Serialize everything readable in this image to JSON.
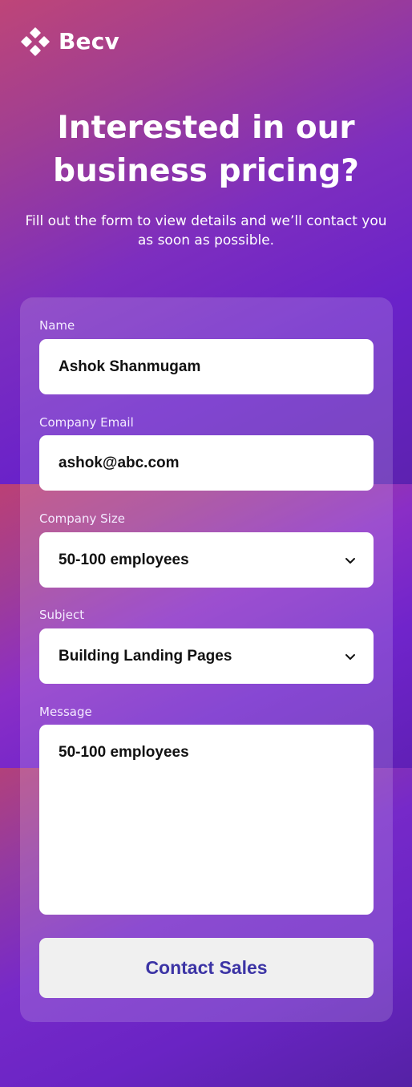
{
  "brand": {
    "name": "Becv",
    "logo_icon": "diamond-grid-logo-icon"
  },
  "hero": {
    "title_line1": "Interested in our",
    "title_line2": "business pricing?",
    "subtitle_line1": "Fill out the form to view details and we’ll contact you",
    "subtitle_line2": "as soon as possible."
  },
  "form": {
    "name": {
      "label": "Name",
      "value": "Ashok Shanmugam"
    },
    "email": {
      "label": "Company Email",
      "value": "ashok@abc.com"
    },
    "company_size": {
      "label": "Company Size",
      "value": "50-100 employees",
      "icon": "chevron-down-icon"
    },
    "subject": {
      "label": "Subject",
      "value": "Building Landing Pages",
      "icon": "chevron-down-icon"
    },
    "message": {
      "label": "Message",
      "value": "50-100 employees"
    },
    "submit_label": "Contact Sales"
  },
  "colors": {
    "accent_button_text": "#3c34a5",
    "button_background": "#f0f0f0",
    "gradient_pink": "#be4578",
    "gradient_purple": "#6a22c9"
  }
}
